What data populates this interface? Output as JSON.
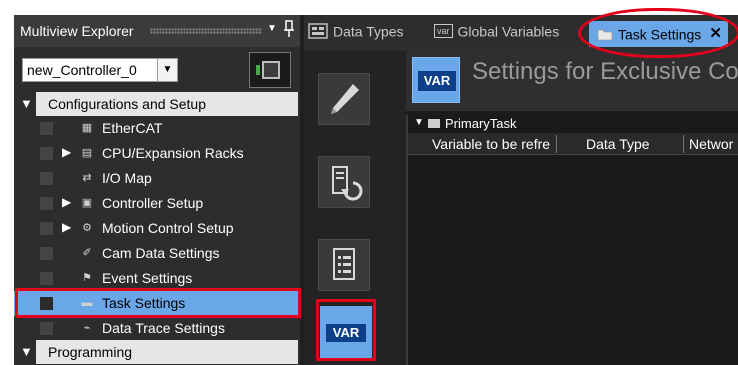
{
  "explorer": {
    "title": "Multiview Explorer",
    "controller": "new_Controller_0",
    "sections": [
      {
        "label": "Configurations and Setup"
      },
      {
        "label": "Programming"
      }
    ],
    "items": [
      {
        "label": "EtherCAT",
        "icon": "ethercat-icon"
      },
      {
        "label": "CPU/Expansion Racks",
        "icon": "rack-icon"
      },
      {
        "label": "I/O Map",
        "icon": "io-map-icon"
      },
      {
        "label": "Controller Setup",
        "icon": "controller-setup-icon"
      },
      {
        "label": "Motion Control Setup",
        "icon": "gear-icon"
      },
      {
        "label": "Cam Data Settings",
        "icon": "cam-icon"
      },
      {
        "label": "Event Settings",
        "icon": "flag-icon"
      },
      {
        "label": "Task Settings",
        "icon": "folder-icon",
        "selected": true
      },
      {
        "label": "Data Trace Settings",
        "icon": "trace-icon"
      }
    ]
  },
  "tabs": {
    "data_types": "Data Types",
    "global_variables": "Global Variables",
    "global_variables_badge": "var",
    "task_settings": "Task Settings",
    "close_glyph": "✕"
  },
  "editor": {
    "badge": "VAR",
    "title": "Settings for Exclusive Co",
    "task_name": "PrimaryTask",
    "columns": [
      "Variable to be refre",
      "Data Type",
      "Networ"
    ],
    "tool_badge": "VAR"
  },
  "colors": {
    "accent": "#6aa7e8",
    "highlight": "#e3001b",
    "panel": "#2d2d2d"
  }
}
